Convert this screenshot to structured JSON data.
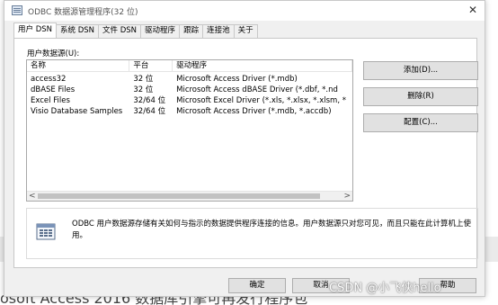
{
  "background": {
    "bottom_text": "osoft Access 2016 数据库引擎可再发行程序包"
  },
  "window": {
    "title": "ODBC 数据源管理程序(32 位)",
    "close_glyph": "✕"
  },
  "tabs": [
    {
      "label": "用户 DSN",
      "active": true
    },
    {
      "label": "系统 DSN",
      "active": false
    },
    {
      "label": "文件 DSN",
      "active": false
    },
    {
      "label": "驱动程序",
      "active": false
    },
    {
      "label": "跟踪",
      "active": false
    },
    {
      "label": "连接池",
      "active": false
    },
    {
      "label": "关于",
      "active": false
    }
  ],
  "user_dsn": {
    "group_label": "用户数据源(U):",
    "columns": [
      "名称",
      "平台",
      "驱动程序"
    ],
    "rows": [
      [
        "access32",
        "32 位",
        "Microsoft Access Driver (*.mdb)"
      ],
      [
        "dBASE Files",
        "32 位",
        "Microsoft Access dBASE Driver (*.dbf, *.nd"
      ],
      [
        "Excel Files",
        "32/64 位",
        "Microsoft Excel Driver (*.xls, *.xlsx, *.xlsm, *"
      ],
      [
        "Visio Database Samples",
        "32/64 位",
        "Microsoft Access Driver (*.mdb, *.accdb)"
      ]
    ],
    "scroll_left": "<",
    "scroll_right": ">",
    "buttons": {
      "add": "添加(D)...",
      "remove": "删除(R)",
      "configure": "配置(C)..."
    },
    "info_text": "ODBC 用户数据源存储有关如何与指示的数据提供程序连接的信息。用户数据源只对您可见，而且只能在此计算机上使用。"
  },
  "footer": {
    "ok": "确定",
    "cancel": "取消",
    "help": "帮助"
  },
  "watermark": "CSDN @小飞侠hello"
}
